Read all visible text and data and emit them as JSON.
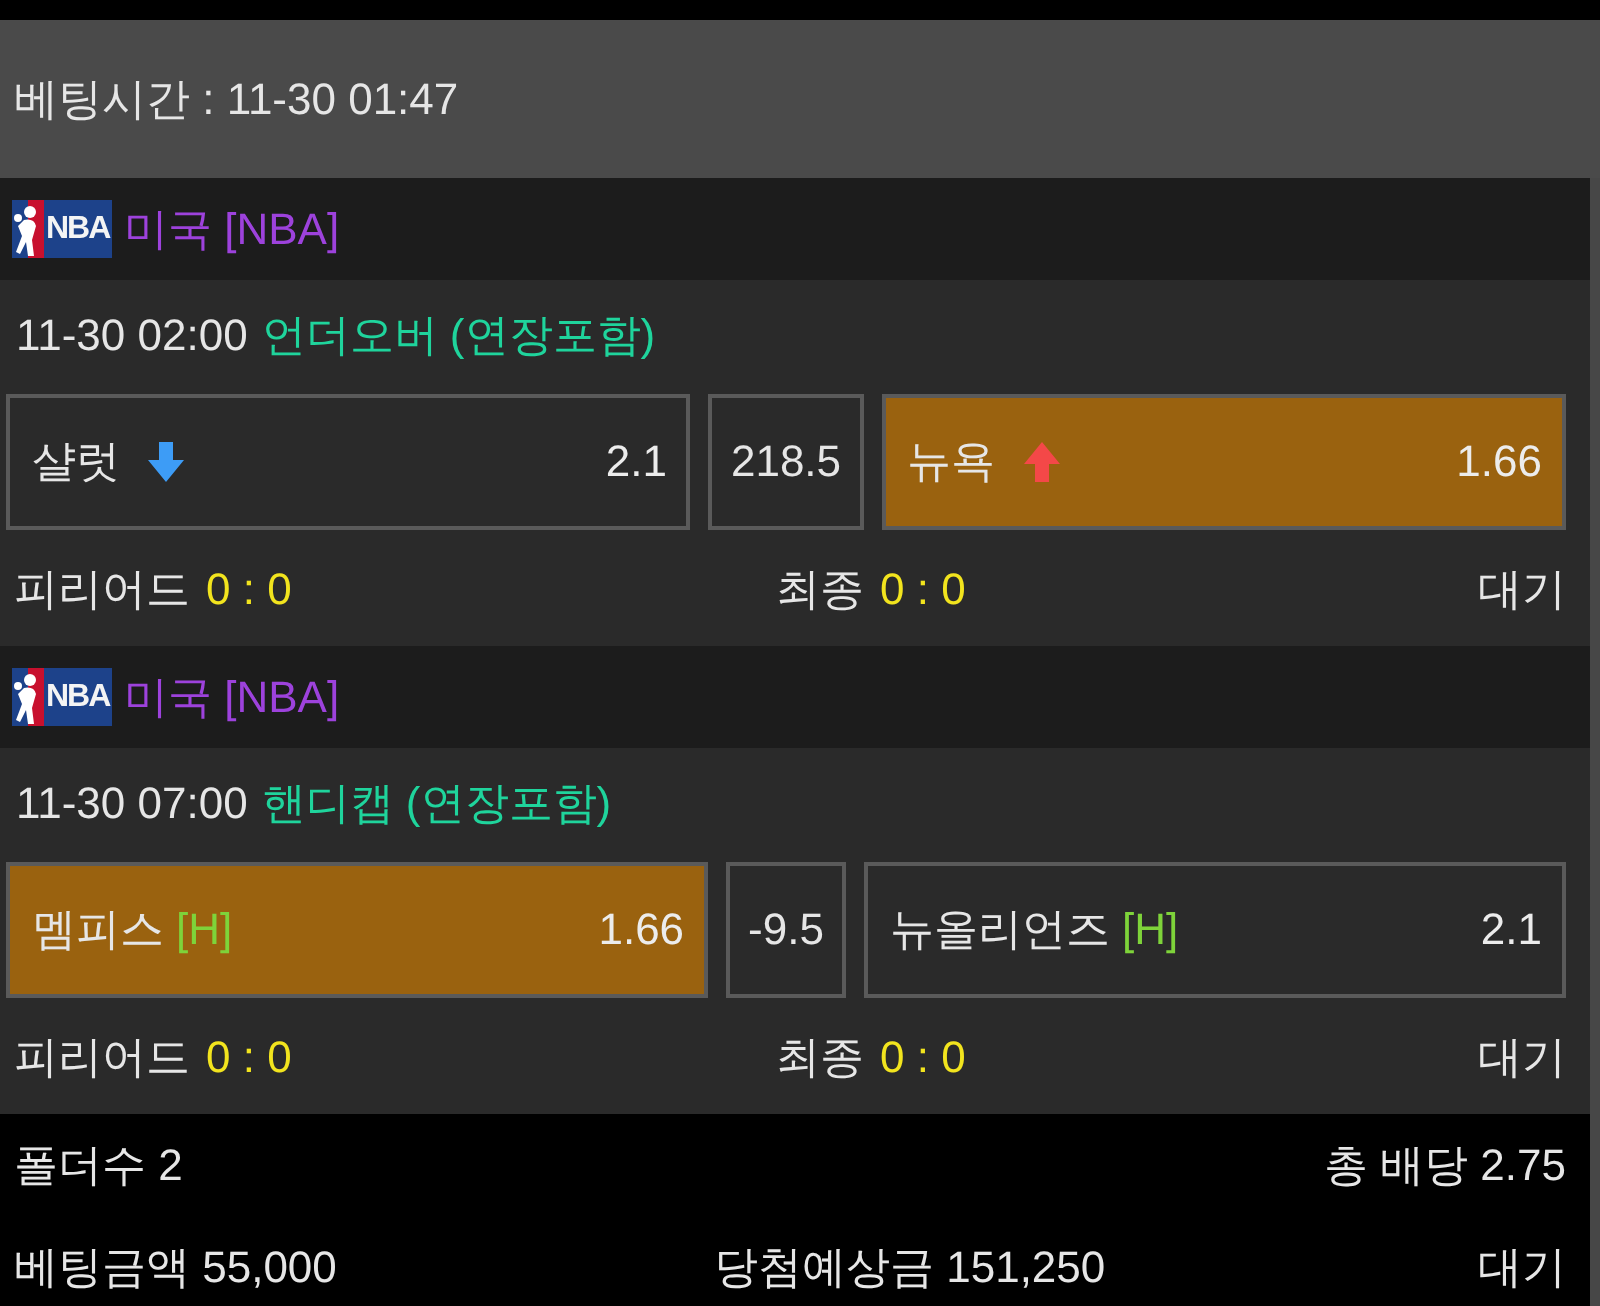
{
  "header": {
    "betting_time": "베팅시간 : 11-30 01:47"
  },
  "matches": [
    {
      "league": {
        "logo_text": "NBA",
        "name": "미국 [NBA]"
      },
      "start_time": "11-30 02:00",
      "market": "언더오버 (연장포함)",
      "options": [
        {
          "team": "샬럿",
          "odds_rising": false,
          "odds": "2.1",
          "selected": false
        },
        {
          "team": "뉴욕",
          "odds_rising": true,
          "odds": "1.66",
          "selected": true
        }
      ],
      "line": "218.5",
      "period_label": "피리어드",
      "period_score": "0 : 0",
      "final_label": "최종",
      "final_score": "0 : 0",
      "status": "대기"
    },
    {
      "league": {
        "logo_text": "NBA",
        "name": "미국 [NBA]"
      },
      "start_time": "11-30 07:00",
      "market": "핸디캡 (연장포함)",
      "options": [
        {
          "team": "멤피스",
          "tag": "[H]",
          "odds": "1.66",
          "selected": true
        },
        {
          "team": "뉴올리언즈",
          "tag": "[H]",
          "odds": "2.1",
          "selected": false
        }
      ],
      "line": "-9.5",
      "period_label": "피리어드",
      "period_score": "0 : 0",
      "final_label": "최종",
      "final_score": "0 : 0",
      "status": "대기"
    }
  ],
  "summary": {
    "folders": "폴더수 2",
    "total_odds": "총 배당 2.75",
    "stake": "베팅금액 55,000",
    "expected_payout": "당첨예상금 151,250",
    "status": "대기"
  }
}
